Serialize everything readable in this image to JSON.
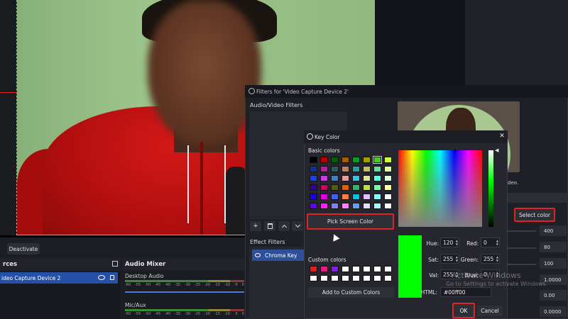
{
  "main": {
    "deactivate_label": "Deactivate",
    "sources_header": "rces",
    "source_item": "ideo Capture Device 2",
    "mixer_header": "Audio Mixer",
    "desktop_audio_label": "Desktop Audio",
    "mic_aux_label": "Mic/Aux",
    "meter_scale": [
      "-60",
      "-55",
      "-50",
      "-45",
      "-40",
      "-35",
      "-30",
      "-25",
      "-20",
      "-15",
      "-10",
      "-5",
      "0"
    ]
  },
  "filters_window": {
    "title": "Filters for 'Video Capture Device 2'",
    "av_filters_label": "Audio/Video Filters",
    "effect_filters_label": "Effect Filters",
    "chroma_key_label": "Chroma Key",
    "partial_label": "deo.",
    "select_color_label": "Select color",
    "spin_values": [
      "400",
      "80",
      "100",
      "1.0000",
      "0.00",
      "0.0000"
    ],
    "icons": {
      "add": "+",
      "delete": "trash-icon",
      "up": "^",
      "down": "v"
    }
  },
  "key_color_dialog": {
    "title": "Key Color",
    "basic_colors_label": "Basic colors",
    "basic_colors": [
      "#000000",
      "#b00000",
      "#006000",
      "#a06000",
      "#00a020",
      "#a0a000",
      "#40d020",
      "#d0ff40",
      "#1030a0",
      "#b020a0",
      "#206060",
      "#c08060",
      "#20a0a0",
      "#c0c060",
      "#60e0a0",
      "#e0ffa0",
      "#2040e0",
      "#c040e0",
      "#4080c0",
      "#e0a0a0",
      "#40c0e0",
      "#e0e0a0",
      "#60ffe0",
      "#e0ffe0",
      "#3000a0",
      "#d00060",
      "#506000",
      "#e06000",
      "#20c060",
      "#c0e040",
      "#70ffa0",
      "#ffffa0",
      "#2000e0",
      "#e000e0",
      "#4060ff",
      "#ff8040",
      "#00c0e0",
      "#e0c0ff",
      "#80ffff",
      "#ffffff",
      "#6000ff",
      "#ff20ff",
      "#8080ff",
      "#ff80ff",
      "#60a0ff",
      "#e0e0ff",
      "#a0ffff",
      "#ffffff"
    ],
    "pick_screen_label": "Pick Screen Color",
    "custom_colors_label": "Custom colors",
    "custom_colors": [
      "#e02020",
      "#e02080",
      "#8020e0",
      "#ffffff",
      "#ffffff",
      "#ffffff",
      "#ffffff",
      "#ffffff",
      "#ffffff",
      "#ffffff",
      "#ffffff",
      "#ffffff",
      "#ffffff",
      "#ffffff",
      "#ffffff",
      "#ffffff"
    ],
    "add_custom_label": "Add to Custom Colors",
    "hue_label": "Hue:",
    "hue_value": "120",
    "sat_label": "Sat:",
    "sat_value": "255",
    "val_label": "Val:",
    "val_value": "255",
    "red_label": "Red:",
    "red_value": "0",
    "green_label": "Green:",
    "green_value": "255",
    "blue_label": "Blue:",
    "blue_value": "0",
    "html_label": "HTML:",
    "html_value": "#00ff00",
    "ok_label": "OK",
    "cancel_label": "Cancel",
    "current_color": "#00ff00"
  },
  "watermark": {
    "line1": "Activate Windows",
    "line2": "Go to Settings to activate Windows."
  }
}
